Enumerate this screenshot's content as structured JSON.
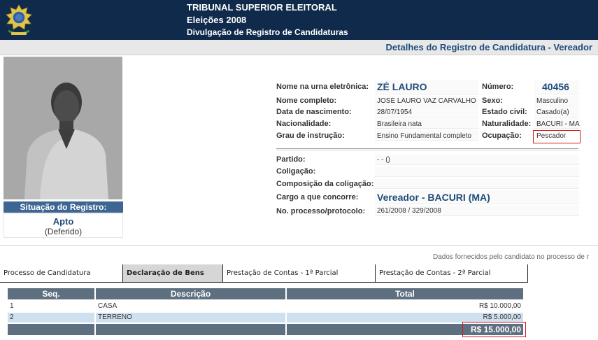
{
  "header": {
    "line1": "TRIBUNAL SUPERIOR ELEITORAL",
    "line2": "Eleições 2008",
    "line3": "Divulgação de Registro de Candidaturas"
  },
  "page_title": "Detalhes do Registro de Candidatura - Vereador",
  "status": {
    "label": "Situação do Registro:",
    "value": "Apto",
    "sub": "(Deferido)"
  },
  "details": {
    "urna_label": "Nome na urna eletrônica:",
    "urna_value": "ZÉ LAURO",
    "numero_label": "Número:",
    "numero_value": "40456",
    "nome_label": "Nome completo:",
    "nome_value": "JOSÉ LAURO VAZ CARVALHO",
    "sexo_label": "Sexo:",
    "sexo_value": "Masculino",
    "nasc_label": "Data de nascimento:",
    "nasc_value": "28/07/1954",
    "civil_label": "Estado civil:",
    "civil_value": "Casado(a)",
    "nac_label": "Nacionalidade:",
    "nac_value": "Brasileira nata",
    "natur_label": "Naturalidade:",
    "natur_value": "BACURI - MA",
    "grau_label": "Grau de instrução:",
    "grau_value": "Ensino Fundamental completo",
    "ocup_label": "Ocupação:",
    "ocup_value": "Pescador",
    "partido_label": "Partido:",
    "partido_value": "- - ()",
    "coligacao_label": "Coligação:",
    "coligacao_value": "",
    "composicao_label": "Composição da coligação:",
    "composicao_value": "",
    "cargo_label": "Cargo a que concorre:",
    "cargo_value": "Vereador - BACURI (MA)",
    "processo_label": "No. processo/protocolo:",
    "processo_value": "261/2008 / 329/2008"
  },
  "notice": "Dados fornecidos pelo candidato no processo de r",
  "tabs": [
    "Processo de Candidatura",
    "Declaração de Bens",
    "Prestação de Contas - 1ª Parcial",
    "Prestação de Contas - 2ª Parcial"
  ],
  "table": {
    "headers": [
      "Seq.",
      "Descrição",
      "Total"
    ],
    "rows": [
      [
        "1",
        "CASA",
        "R$ 10.000,00"
      ],
      [
        "2",
        "TERRENO",
        "R$ 5.000,00"
      ]
    ],
    "total": "R$ 15.000,00"
  },
  "colors": {
    "header_bg": "#0f2a4a",
    "title_text": "#1f4d7a",
    "status_bg": "#3e6692",
    "table_head": "#5e6f80",
    "highlight": "#d01c1c"
  },
  "icons": {
    "emblem": "brazil-coat-of-arms-icon"
  }
}
